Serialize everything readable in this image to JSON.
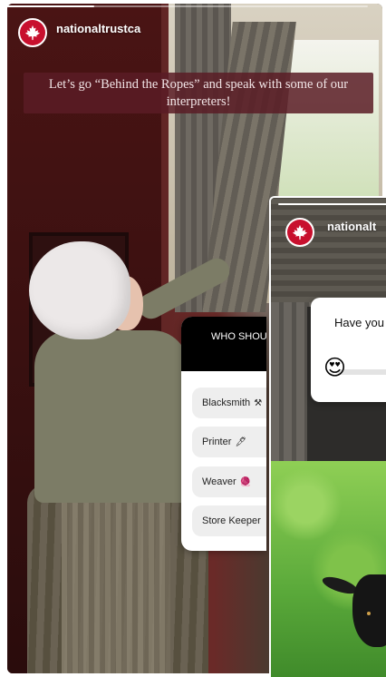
{
  "back_story": {
    "account_name": "nationaltrustca",
    "progress": 0.24,
    "caption": "Let’s go “Behind the Ropes” and speak with some of our interpreters!",
    "quiz": {
      "question": "WHO SHOULD WE F",
      "options": [
        {
          "label": "Blacksmith",
          "icon": "⚒"
        },
        {
          "label": "Printer",
          "icon": "🖋"
        },
        {
          "label": "Weaver",
          "icon": "🧶"
        },
        {
          "label": "Store Keeper",
          "icon": ""
        }
      ]
    }
  },
  "front_story": {
    "account_name": "nationalt",
    "progress": 1.0,
    "slider": {
      "question": "Have you",
      "emoji": "😍"
    }
  },
  "colors": {
    "brand_red": "#c8102e",
    "caption_bg": "#5a1c26",
    "quiz_header_bg": "#000000"
  },
  "icons": [
    "maple-leaf-icon",
    "hammer-icon",
    "quill-icon",
    "yarn-icon",
    "heart-eyes-emoji"
  ]
}
